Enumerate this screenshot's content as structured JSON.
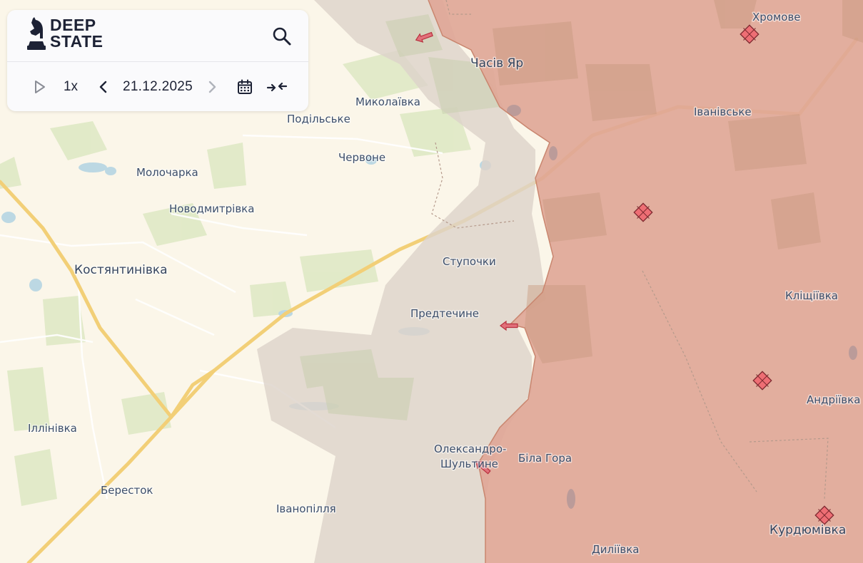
{
  "app": {
    "brand_line1": "DEEP",
    "brand_line2": "STATE",
    "logo_icon": "knight-chess-icon"
  },
  "controls": {
    "play_icon": "play-icon",
    "speed": "1x",
    "prev_icon": "chevron-left-icon",
    "date": "21.12.2025",
    "next_icon": "chevron-right-icon",
    "calendar_icon": "calendar-icon",
    "compare_icon": "collapse-arrows-icon",
    "search_icon": "search-icon"
  },
  "colors": {
    "base_map": "#fbf6e9",
    "occupied_zone": "#e0aa9c",
    "gray_zone": "#ddd5cc",
    "road_major": "#f3d27a",
    "forest": "#dfe9c6",
    "water": "#b9d6e0",
    "attack_marker": "#e05a64",
    "border": "#c9866f"
  },
  "places": [
    {
      "id": "khromove",
      "name": "Хромове"
    },
    {
      "id": "chasiv-yar",
      "name": "Часів Яр"
    },
    {
      "id": "mykolaivka",
      "name": "Миколаївка"
    },
    {
      "id": "ivanivske",
      "name": "Іванівське"
    },
    {
      "id": "podilske",
      "name": "Подільське"
    },
    {
      "id": "chervone",
      "name": "Червоне"
    },
    {
      "id": "molocharka",
      "name": "Молочарка"
    },
    {
      "id": "novodmytrivka",
      "name": "Новодмитрівка"
    },
    {
      "id": "kostiantynivka",
      "name": "Костянтинівка"
    },
    {
      "id": "stupochky",
      "name": "Ступочки"
    },
    {
      "id": "klishchiivka",
      "name": "Кліщіївка"
    },
    {
      "id": "predtechyne",
      "name": "Предтечине"
    },
    {
      "id": "andriivka",
      "name": "Андріївка"
    },
    {
      "id": "illinivka",
      "name": "Іллінівка"
    },
    {
      "id": "oleksandro",
      "name": "Олександро-"
    },
    {
      "id": "shultyne",
      "name": "Шультине"
    },
    {
      "id": "bila-hora",
      "name": "Біла Гора"
    },
    {
      "id": "berestok",
      "name": "Бересток"
    },
    {
      "id": "ivanopillia",
      "name": "Іванопілля"
    },
    {
      "id": "kurdiumivka",
      "name": "Курдюмівка"
    },
    {
      "id": "dyliivka",
      "name": "Диліївка"
    }
  ],
  "markers": {
    "attack_direction_icon": "attack-arrow-icon",
    "occupied_settlement_icon": "red-diamond-grid-icon"
  }
}
